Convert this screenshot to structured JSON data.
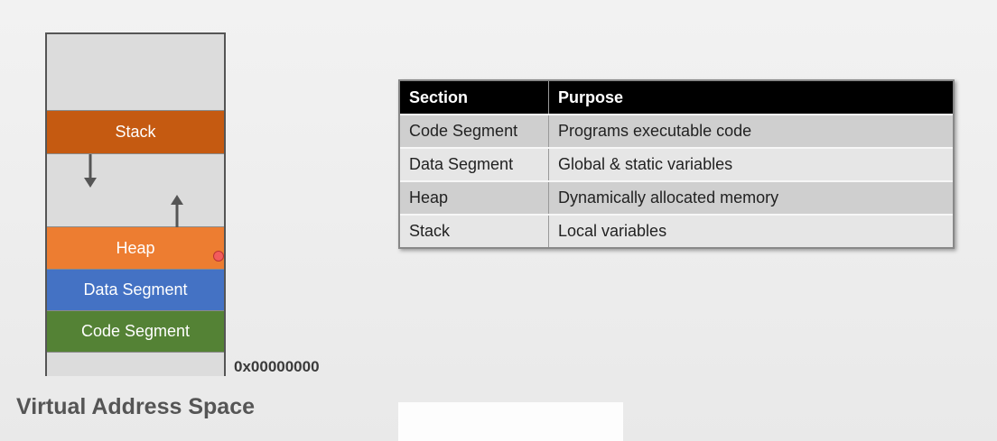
{
  "diagram": {
    "segments": {
      "stack": "Stack",
      "heap": "Heap",
      "data": "Data Segment",
      "code": "Code Segment"
    },
    "address_label": "0x00000000",
    "title": "Virtual Address Space",
    "colors": {
      "stack": "#c55a11",
      "heap": "#ed7d31",
      "data": "#4472c4",
      "code": "#548235",
      "empty": "#dcdcdc"
    }
  },
  "table": {
    "headers": [
      "Section",
      "Purpose"
    ],
    "rows": [
      [
        "Code Segment",
        "Programs executable code"
      ],
      [
        "Data Segment",
        "Global & static variables"
      ],
      [
        "Heap",
        "Dynamically allocated memory"
      ],
      [
        "Stack",
        "Local variables"
      ]
    ]
  }
}
